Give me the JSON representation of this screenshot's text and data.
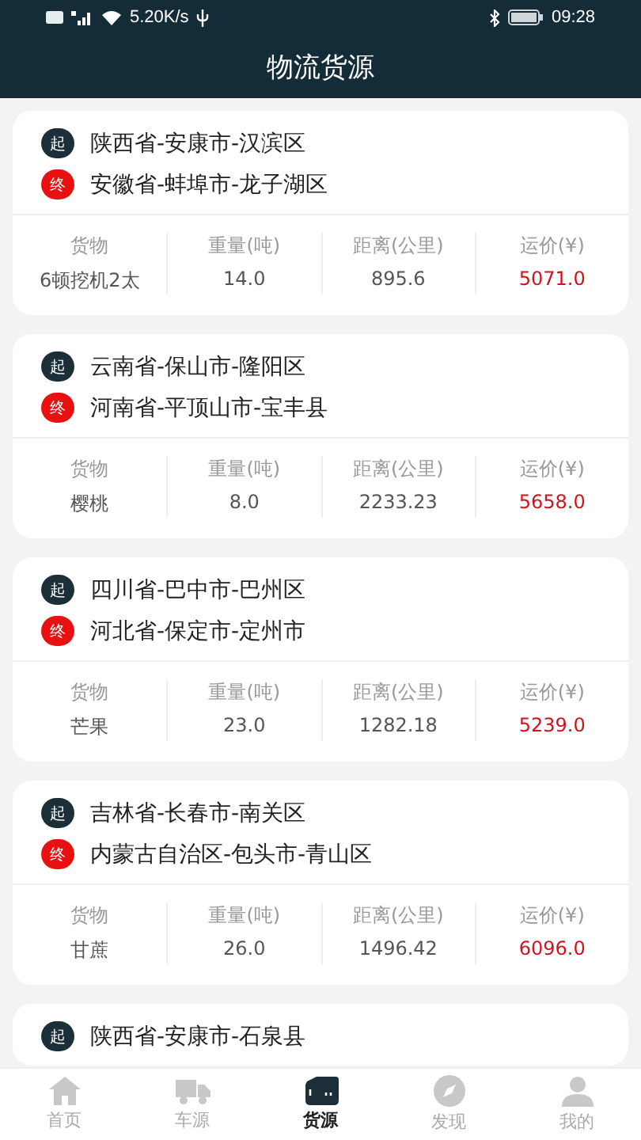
{
  "status_bar": {
    "speed": "5.20K/s",
    "time": "09:28"
  },
  "header": {
    "title": "物流货源"
  },
  "cards": [
    {
      "stops": [
        {
          "kind": "origin",
          "badge": "起",
          "place": "陕西省-安康市-汉滨区"
        },
        {
          "kind": "destination",
          "badge": "终",
          "place": "安徽省-蚌埠市-龙子湖区"
        }
      ],
      "stats": [
        {
          "kind": "plain",
          "label": "货物",
          "value": "6顿挖机2太"
        },
        {
          "kind": "plain",
          "label": "重量(吨)",
          "value": "14.0"
        },
        {
          "kind": "plain",
          "label": "距离(公里)",
          "value": "895.6"
        },
        {
          "kind": "price",
          "label": "运价(¥)",
          "value": "5071.0"
        }
      ]
    },
    {
      "stops": [
        {
          "kind": "origin",
          "badge": "起",
          "place": "云南省-保山市-隆阳区"
        },
        {
          "kind": "destination",
          "badge": "终",
          "place": "河南省-平顶山市-宝丰县"
        }
      ],
      "stats": [
        {
          "kind": "plain",
          "label": "货物",
          "value": "樱桃"
        },
        {
          "kind": "plain",
          "label": "重量(吨)",
          "value": "8.0"
        },
        {
          "kind": "plain",
          "label": "距离(公里)",
          "value": "2233.23"
        },
        {
          "kind": "price",
          "label": "运价(¥)",
          "value": "5658.0"
        }
      ]
    },
    {
      "stops": [
        {
          "kind": "origin",
          "badge": "起",
          "place": "四川省-巴中市-巴州区"
        },
        {
          "kind": "destination",
          "badge": "终",
          "place": "河北省-保定市-定州市"
        }
      ],
      "stats": [
        {
          "kind": "plain",
          "label": "货物",
          "value": "芒果"
        },
        {
          "kind": "plain",
          "label": "重量(吨)",
          "value": "23.0"
        },
        {
          "kind": "plain",
          "label": "距离(公里)",
          "value": "1282.18"
        },
        {
          "kind": "price",
          "label": "运价(¥)",
          "value": "5239.0"
        }
      ]
    },
    {
      "stops": [
        {
          "kind": "origin",
          "badge": "起",
          "place": "吉林省-长春市-南关区"
        },
        {
          "kind": "destination",
          "badge": "终",
          "place": "内蒙古自治区-包头市-青山区"
        }
      ],
      "stats": [
        {
          "kind": "plain",
          "label": "货物",
          "value": "甘蔗"
        },
        {
          "kind": "plain",
          "label": "重量(吨)",
          "value": "26.0"
        },
        {
          "kind": "plain",
          "label": "距离(公里)",
          "value": "1496.42"
        },
        {
          "kind": "price",
          "label": "运价(¥)",
          "value": "6096.0"
        }
      ]
    },
    {
      "stops": [
        {
          "kind": "origin",
          "badge": "起",
          "place": "陕西省-安康市-石泉县"
        }
      ]
    }
  ],
  "nav": [
    {
      "kind": "home",
      "label": "首页",
      "selected": false
    },
    {
      "kind": "truck",
      "label": "车源",
      "selected": false
    },
    {
      "kind": "box",
      "label": "货源",
      "selected": true
    },
    {
      "kind": "compass",
      "label": "发现",
      "selected": false
    },
    {
      "kind": "person",
      "label": "我的",
      "selected": false
    }
  ]
}
